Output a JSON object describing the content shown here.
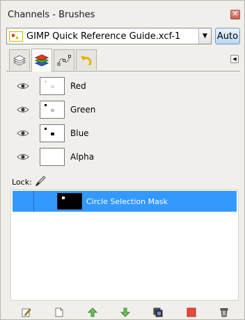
{
  "window": {
    "title": "Channels - Brushes"
  },
  "image_selector": {
    "value": "GIMP Quick Reference Guide.xcf-1",
    "auto_label": "Auto"
  },
  "tabs": [
    {
      "icon": "layers-icon"
    },
    {
      "icon": "channels-icon",
      "active": true
    },
    {
      "icon": "paths-icon"
    },
    {
      "icon": "undo-history-icon"
    }
  ],
  "channels": [
    {
      "label": "Red"
    },
    {
      "label": "Green"
    },
    {
      "label": "Blue"
    },
    {
      "label": "Alpha"
    }
  ],
  "lock": {
    "label": "Lock:"
  },
  "selection_masks": [
    {
      "label": "Circle Selection Mask",
      "selected": true
    }
  ],
  "toolbar": [
    {
      "icon": "edit-channel-icon"
    },
    {
      "icon": "new-channel-icon"
    },
    {
      "icon": "raise-channel-icon"
    },
    {
      "icon": "lower-channel-icon"
    },
    {
      "icon": "duplicate-channel-icon"
    },
    {
      "icon": "channel-to-selection-icon"
    },
    {
      "icon": "delete-channel-icon"
    }
  ],
  "colors": {
    "selection": "#3399ff",
    "window_bg": "#f0efec"
  }
}
